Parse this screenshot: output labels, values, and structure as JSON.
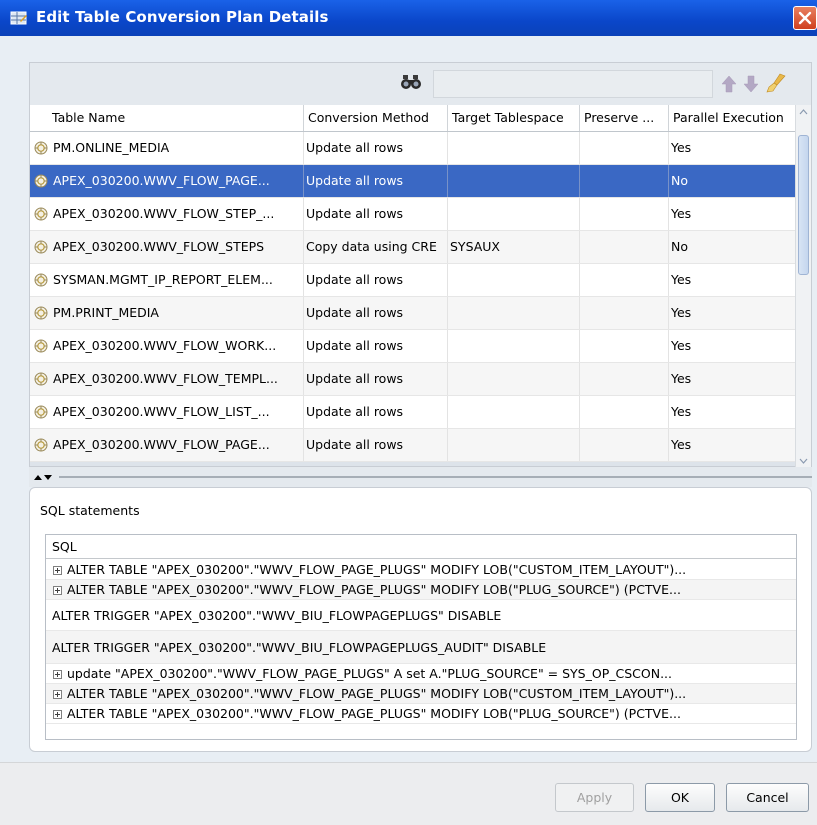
{
  "window": {
    "title": "Edit Table Conversion Plan Details"
  },
  "search": {
    "value": ""
  },
  "table": {
    "columns": [
      "Table Name",
      "Conversion Method",
      "Target Tablespace",
      "Preserve ...",
      "Parallel Execution"
    ],
    "rows": [
      {
        "name": "PM.ONLINE_MEDIA",
        "method": "Update all rows",
        "tablespace": "",
        "preserve": "",
        "parallel": "Yes"
      },
      {
        "name": "APEX_030200.WWV_FLOW_PAGE...",
        "method": "Update all rows",
        "tablespace": "",
        "preserve": "",
        "parallel": "No",
        "selected": true
      },
      {
        "name": "APEX_030200.WWV_FLOW_STEP_...",
        "method": "Update all rows",
        "tablespace": "",
        "preserve": "",
        "parallel": "Yes"
      },
      {
        "name": "APEX_030200.WWV_FLOW_STEPS",
        "method": "Copy data using CRE",
        "tablespace": "SYSAUX",
        "preserve": "",
        "parallel": "No"
      },
      {
        "name": "SYSMAN.MGMT_IP_REPORT_ELEM...",
        "method": "Update all rows",
        "tablespace": "",
        "preserve": "",
        "parallel": "Yes"
      },
      {
        "name": "PM.PRINT_MEDIA",
        "method": "Update all rows",
        "tablespace": "",
        "preserve": "",
        "parallel": "Yes"
      },
      {
        "name": "APEX_030200.WWV_FLOW_WORK...",
        "method": "Update all rows",
        "tablespace": "",
        "preserve": "",
        "parallel": "Yes"
      },
      {
        "name": "APEX_030200.WWV_FLOW_TEMPL...",
        "method": "Update all rows",
        "tablespace": "",
        "preserve": "",
        "parallel": "Yes"
      },
      {
        "name": "APEX_030200.WWV_FLOW_LIST_...",
        "method": "Update all rows",
        "tablespace": "",
        "preserve": "",
        "parallel": "Yes"
      },
      {
        "name": "APEX_030200.WWV_FLOW_PAGE...",
        "method": "Update all rows",
        "tablespace": "",
        "preserve": "",
        "parallel": "Yes"
      }
    ]
  },
  "sql": {
    "label": "SQL statements",
    "column": "SQL",
    "rows": [
      {
        "text": "ALTER TABLE \"APEX_030200\".\"WWV_FLOW_PAGE_PLUGS\" MODIFY LOB(\"CUSTOM_ITEM_LAYOUT\")...",
        "expandable": true
      },
      {
        "text": "ALTER TABLE \"APEX_030200\".\"WWV_FLOW_PAGE_PLUGS\" MODIFY LOB(\"PLUG_SOURCE\") (PCTVE...",
        "expandable": true
      },
      {
        "text": "ALTER TRIGGER \"APEX_030200\".\"WWV_BIU_FLOWPAGEPLUGS\" DISABLE",
        "expandable": false
      },
      {
        "text": "ALTER TRIGGER \"APEX_030200\".\"WWV_BIU_FLOWPAGEPLUGS_AUDIT\" DISABLE",
        "expandable": false
      },
      {
        "text": "update \"APEX_030200\".\"WWV_FLOW_PAGE_PLUGS\" A  set A.\"PLUG_SOURCE\" = SYS_OP_CSCON...",
        "expandable": true
      },
      {
        "text": "ALTER TABLE \"APEX_030200\".\"WWV_FLOW_PAGE_PLUGS\" MODIFY LOB(\"CUSTOM_ITEM_LAYOUT\")...",
        "expandable": true
      },
      {
        "text": "ALTER TABLE \"APEX_030200\".\"WWV_FLOW_PAGE_PLUGS\" MODIFY LOB(\"PLUG_SOURCE\") (PCTVE...",
        "expandable": true
      }
    ]
  },
  "buttons": {
    "apply": "Apply",
    "ok": "OK",
    "cancel": "Cancel"
  },
  "icons": {
    "app": "edit-table-app-icon",
    "close": "close-icon",
    "find": "binoculars-icon",
    "up": "move-up-icon",
    "down": "move-down-icon",
    "clear": "clear-brush-icon",
    "row": "table-status-icon",
    "expand": "expand-plus-icon"
  },
  "colors": {
    "selection": "#3a68c4",
    "titlebar": "#0a46c9",
    "close": "#d0401e"
  }
}
